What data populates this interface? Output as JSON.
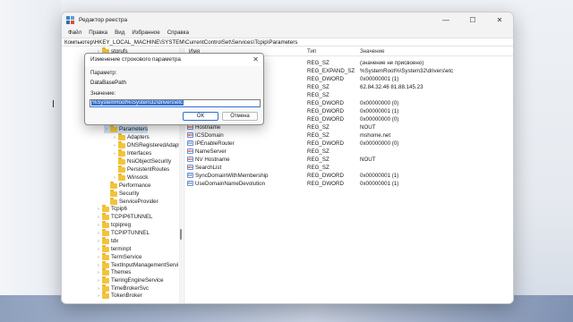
{
  "window": {
    "title": "Редактор реестра",
    "controls": {
      "minimize": "—",
      "maximize": "☐",
      "close": "✕"
    }
  },
  "menu": [
    "Файл",
    "Правка",
    "Вид",
    "Избранное",
    "Справка"
  ],
  "address": "Компьютер\\HKEY_LOCAL_MACHINE\\SYSTEM\\CurrentControlSet\\Services\\Tcpip\\Parameters",
  "tree": {
    "items": [
      {
        "label": "storufs",
        "expandable": true,
        "indent": 2
      },
      {
        "label": "Parameters",
        "expandable": true,
        "indent": 3,
        "selected": true
      },
      {
        "label": "Adapters",
        "expandable": true,
        "indent": 4
      },
      {
        "label": "DNSRegisteredAdapt",
        "expandable": true,
        "indent": 4
      },
      {
        "label": "Interfaces",
        "expandable": true,
        "indent": 4
      },
      {
        "label": "NsiObjectSecurity",
        "expandable": false,
        "indent": 4
      },
      {
        "label": "PersistentRoutes",
        "expandable": false,
        "indent": 4
      },
      {
        "label": "Winsock",
        "expandable": true,
        "indent": 4
      },
      {
        "label": "Performance",
        "expandable": false,
        "indent": 3
      },
      {
        "label": "Security",
        "expandable": false,
        "indent": 3
      },
      {
        "label": "ServiceProvider",
        "expandable": false,
        "indent": 3
      },
      {
        "label": "Tcpip6",
        "expandable": true,
        "indent": 2
      },
      {
        "label": "TCPIP6TUNNEL",
        "expandable": true,
        "indent": 2
      },
      {
        "label": "tcpipreg",
        "expandable": true,
        "indent": 2
      },
      {
        "label": "TCPIPTUNNEL",
        "expandable": true,
        "indent": 2
      },
      {
        "label": "tdx",
        "expandable": true,
        "indent": 2
      },
      {
        "label": "terminpt",
        "expandable": true,
        "indent": 2
      },
      {
        "label": "TermService",
        "expandable": true,
        "indent": 2
      },
      {
        "label": "TextInputManagementServi",
        "expandable": true,
        "indent": 2
      },
      {
        "label": "Themes",
        "expandable": true,
        "indent": 2
      },
      {
        "label": "TieringEngineService",
        "expandable": true,
        "indent": 2
      },
      {
        "label": "TimeBrokerSvc",
        "expandable": true,
        "indent": 2
      },
      {
        "label": "TokenBroker",
        "expandable": true,
        "indent": 2
      }
    ]
  },
  "list": {
    "columns": {
      "name": "Имя",
      "type": "Тип",
      "data": "Значение"
    },
    "rows": [
      {
        "name": "",
        "type": "REG_SZ",
        "data": "(значение не присвоено)",
        "icon": "string-value-icon"
      },
      {
        "name": "",
        "type": "REG_EXPAND_SZ",
        "data": "%SystemRoot%\\System32\\drivers\\etc",
        "icon": "string-value-icon"
      },
      {
        "name": "",
        "type": "REG_DWORD",
        "data": "0x00000001 (1)",
        "icon": "dword-value-icon"
      },
      {
        "name": "",
        "type": "REG_SZ",
        "data": "62.84.32.46 81.88.145.23",
        "icon": "string-value-icon"
      },
      {
        "name": "",
        "type": "REG_SZ",
        "data": "",
        "icon": "string-value-icon"
      },
      {
        "name": "ault",
        "type": "REG_DWORD",
        "data": "0x00000000 (0)",
        "icon": "dword-value-icon"
      },
      {
        "name": "",
        "type": "REG_DWORD",
        "data": "0x00000001 (1)",
        "icon": "dword-value-icon"
      },
      {
        "name": "",
        "type": "REG_DWORD",
        "data": "0x00000000 (0)",
        "icon": "dword-value-icon"
      },
      {
        "name": "Hostname",
        "type": "REG_SZ",
        "data": "NOUT",
        "icon": "string-value-icon"
      },
      {
        "name": "ICSDomain",
        "type": "REG_SZ",
        "data": "mshome.net",
        "icon": "string-value-icon"
      },
      {
        "name": "IPEnableRouter",
        "type": "REG_DWORD",
        "data": "0x00000000 (0)",
        "icon": "dword-value-icon"
      },
      {
        "name": "NameServer",
        "type": "REG_SZ",
        "data": "",
        "icon": "string-value-icon"
      },
      {
        "name": "NV Hostname",
        "type": "REG_SZ",
        "data": "NOUT",
        "icon": "string-value-icon"
      },
      {
        "name": "SearchList",
        "type": "REG_SZ",
        "data": "",
        "icon": "string-value-icon"
      },
      {
        "name": "SyncDomainWithMembership",
        "type": "REG_DWORD",
        "data": "0x00000001 (1)",
        "icon": "dword-value-icon"
      },
      {
        "name": "UseDomainNameDevolution",
        "type": "REG_DWORD",
        "data": "0x00000001 (1)",
        "icon": "dword-value-icon"
      }
    ]
  },
  "dialog": {
    "title": "Изменение строкового параметра",
    "close": "✕",
    "param_label": "Параметр:",
    "param_value": "DataBasePath",
    "value_label": "Значение:",
    "value_input": "%SystemRoot%\\System32\\drivers\\etc",
    "ok": "ОК",
    "cancel": "Отмена"
  }
}
